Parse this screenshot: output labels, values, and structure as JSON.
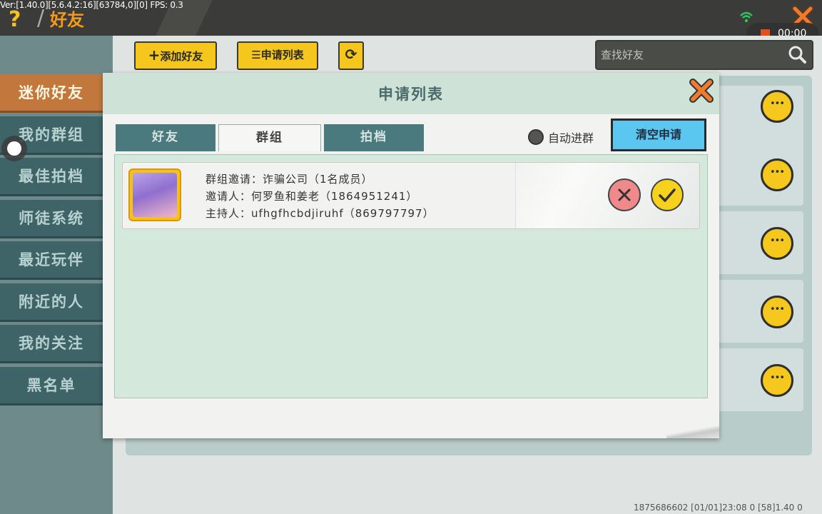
{
  "debug_text": "Ver:[1.40.0][5.6.4.2:16][63784,0][0] FPS: 0.3",
  "header": {
    "help": "?",
    "separator": "/",
    "title": "好友"
  },
  "recording": {
    "time": "00:00"
  },
  "sidebar": {
    "items": [
      {
        "label": "迷你好友",
        "active": true
      },
      {
        "label": "我的群组",
        "active": false
      },
      {
        "label": "最佳拍档",
        "active": false
      },
      {
        "label": "师徒系统",
        "active": false
      },
      {
        "label": "最近玩伴",
        "active": false
      },
      {
        "label": "附近的人",
        "active": false
      },
      {
        "label": "我的关注",
        "active": false
      },
      {
        "label": "黑名单",
        "active": false
      }
    ]
  },
  "toolbar": {
    "add_friend": "添加好友",
    "request_list": "申请列表"
  },
  "search": {
    "placeholder": "查找好友"
  },
  "modal": {
    "title": "申请列表",
    "tabs": [
      {
        "label": "好友",
        "selected": false
      },
      {
        "label": "群组",
        "selected": true
      },
      {
        "label": "拍档",
        "selected": false
      }
    ],
    "auto_join": "自动进群",
    "clear_button": "清空申请",
    "request": {
      "group_line": "群组邀请：诈骗公司（1名成员）",
      "inviter_line": "邀请人：何罗鱼和姜老（1864951241）",
      "host_line": "主持人：ufhgfhcbdjiruhf（869797797）"
    }
  },
  "footer": {
    "info": "1875686602   [01/01]23:08 0  [58]1.40 0"
  },
  "colors": {
    "accent_orange": "#c2773d",
    "tab_teal": "#4a7a7e",
    "button_yellow": "#f5c61e",
    "clear_blue": "#5bc6f0"
  }
}
